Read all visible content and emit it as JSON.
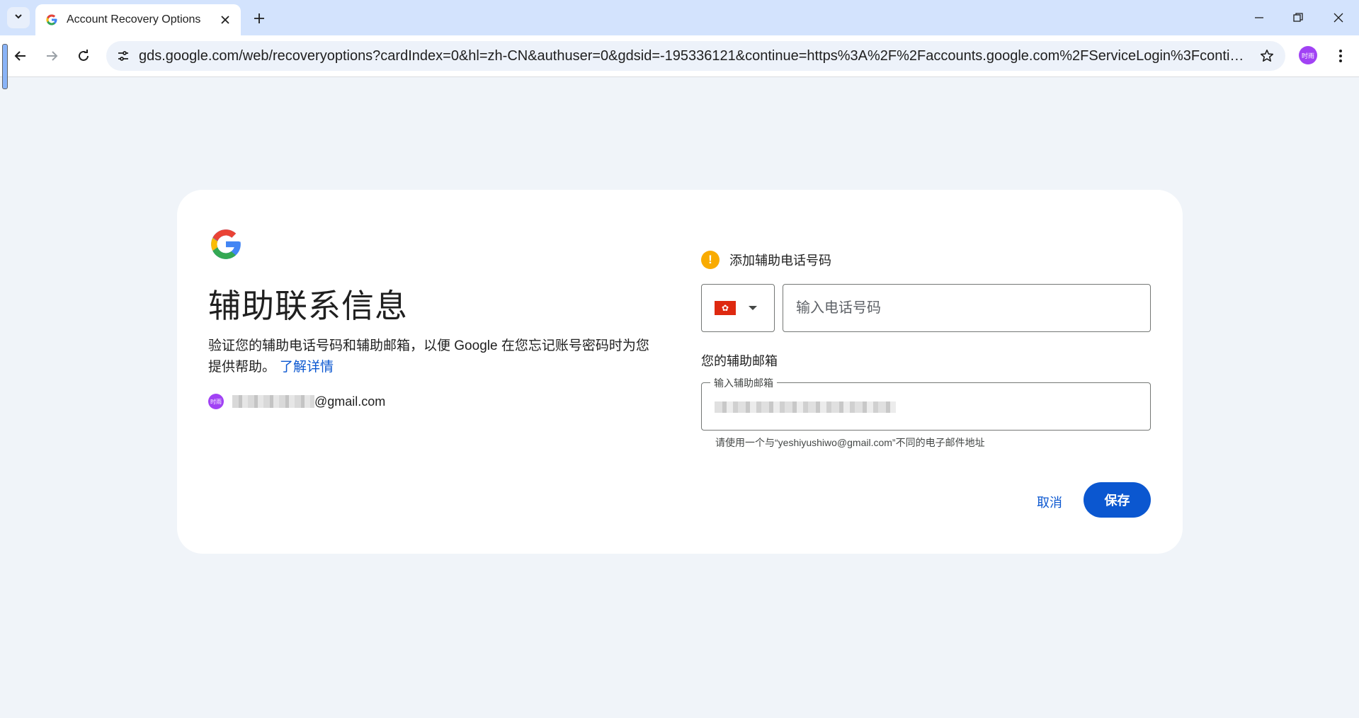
{
  "browser": {
    "tab_title": "Account Recovery Options",
    "url": "gds.google.com/web/recoveryoptions?cardIndex=0&hl=zh-CN&authuser=0&gdsid=-195336121&continue=https%3A%2F%2Faccounts.google.com%2FServiceLogin%3Fcontinue%3Dh...",
    "profile_avatar_text": "时雨",
    "icons": [
      "chevron-down-icon",
      "google-favicon-icon",
      "close-icon",
      "plus-icon",
      "minimize-icon",
      "restore-icon",
      "close-window-icon",
      "back-icon",
      "forward-icon",
      "reload-icon",
      "site-info-icon",
      "star-icon",
      "more-vert-icon"
    ]
  },
  "card": {
    "title": "辅助联系信息",
    "description": "验证您的辅助电话号码和辅助邮箱，以便 Google 在您忘记账号密码时为您提供帮助。",
    "learn_more": "了解详情",
    "account_avatar_text": "时雨",
    "account_email_domain": "@gmail.com",
    "phone_warning": "添加辅助电话号码",
    "phone_placeholder": "输入电话号码",
    "country_flag": "hong-kong-flag",
    "email_section_label": "您的辅助邮箱",
    "email_field_label": "输入辅助邮箱",
    "email_helper": "请使用一个与“yeshiyushiwo@gmail.com”不同的电子邮件地址",
    "cancel_label": "取消",
    "save_label": "保存"
  },
  "colors": {
    "accent": "#0b57d0",
    "warning": "#f9ab00",
    "page_bg": "#f0f4f9",
    "tabstrip_bg": "#d3e3fd",
    "avatar": "#a142f4"
  }
}
